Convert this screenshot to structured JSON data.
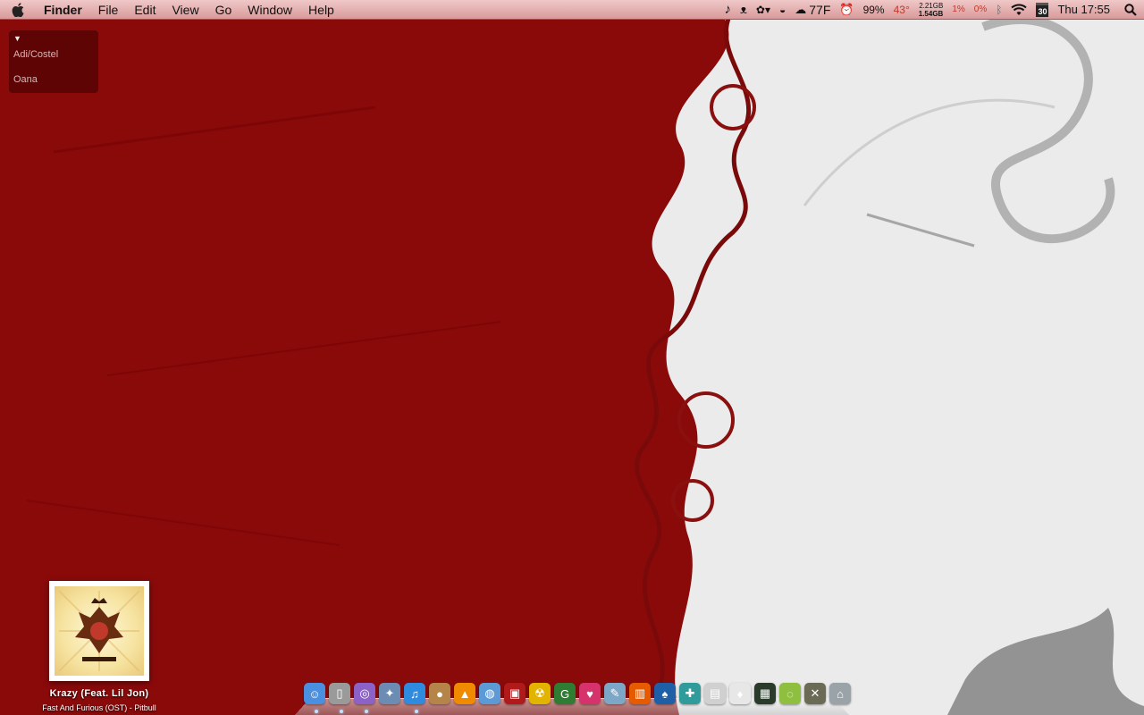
{
  "menubar": {
    "app_name": "Finder",
    "menus": [
      "File",
      "Edit",
      "View",
      "Go",
      "Window",
      "Help"
    ],
    "status": {
      "weather_temp": "77F",
      "battery": "99%",
      "cpu_temp": "43°",
      "mem_top": "2.21GB",
      "mem_bottom": "1.54GB",
      "cpu1": "1%",
      "cpu2": "0%",
      "calendar_day": "30",
      "clock": "Thu 17:55"
    }
  },
  "stack": {
    "items": [
      "Adi/Costel",
      "Oana"
    ]
  },
  "now_playing": {
    "track": "Krazy (Feat. Lil Jon)",
    "artist_line": "Fast And Furious (OST) - Pitbull"
  },
  "dock": {
    "apps": [
      {
        "icon": "finder-icon",
        "color": "#4a8fe0",
        "glyph": "☺"
      },
      {
        "icon": "mouse-icon",
        "color": "#9a9a9a",
        "glyph": "▯"
      },
      {
        "icon": "lasso-icon",
        "color": "#8c62c8",
        "glyph": "◎"
      },
      {
        "icon": "safari-icon",
        "color": "#6d8cb3",
        "glyph": "✦"
      },
      {
        "icon": "itunes-icon",
        "color": "#2e8be0",
        "glyph": "♫"
      },
      {
        "icon": "adium-icon",
        "color": "#b58448",
        "glyph": "●"
      },
      {
        "icon": "vlc-icon",
        "color": "#f08a00",
        "glyph": "▲"
      },
      {
        "icon": "network-icon",
        "color": "#5b9ad6",
        "glyph": "◍"
      },
      {
        "icon": "photobooth-icon",
        "color": "#b01a1a",
        "glyph": "▣"
      },
      {
        "icon": "radiation-icon",
        "color": "#e2b400",
        "glyph": "☢"
      },
      {
        "icon": "google-icon",
        "color": "#2e7d32",
        "glyph": "G"
      },
      {
        "icon": "heart-icon",
        "color": "#d6336c",
        "glyph": "♥"
      },
      {
        "icon": "preview-icon",
        "color": "#7da7c7",
        "glyph": "✎"
      },
      {
        "icon": "stats-icon",
        "color": "#e65a00",
        "glyph": "▥"
      },
      {
        "icon": "cards-icon",
        "color": "#1f5fa8",
        "glyph": "♠"
      },
      {
        "icon": "utilities-icon",
        "color": "#2f9b9b",
        "glyph": "✚"
      },
      {
        "icon": "documents-icon",
        "color": "#d0d0d0",
        "glyph": "▤"
      },
      {
        "icon": "solitaire-icon",
        "color": "#e7e7e7",
        "glyph": "♦"
      },
      {
        "icon": "terminal-icon",
        "color": "#2b3b2b",
        "glyph": "▦"
      },
      {
        "icon": "xcode-icon",
        "color": "#8fbf3f",
        "glyph": "◌"
      },
      {
        "icon": "shield-icon",
        "color": "#6b6b55",
        "glyph": "✕"
      },
      {
        "icon": "trash-icon",
        "color": "#9aa3a8",
        "glyph": "⌂"
      }
    ]
  }
}
